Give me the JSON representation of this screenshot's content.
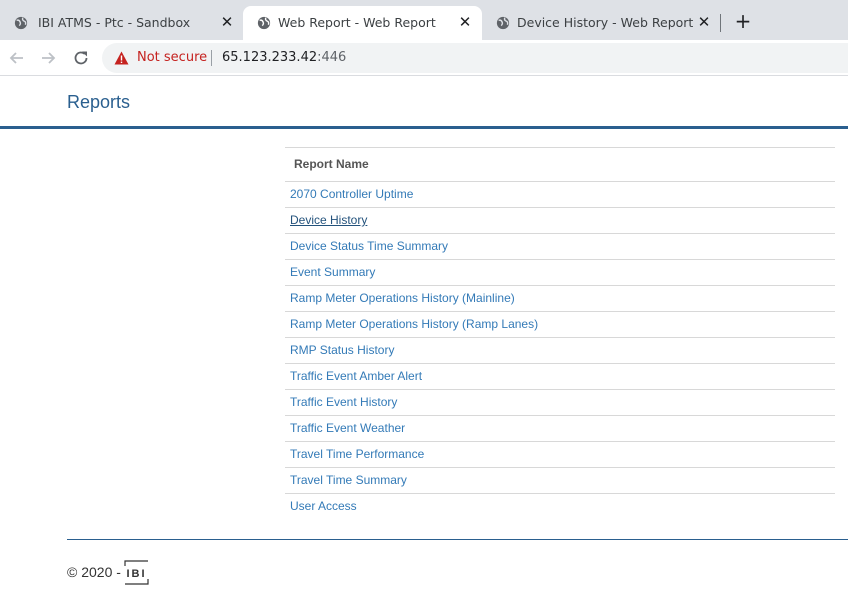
{
  "browser": {
    "tabs": [
      {
        "title": "IBI ATMS - Ptc - Sandbox",
        "close": "✕",
        "active": false
      },
      {
        "title": "Web Report - Web Report",
        "close": "✕",
        "active": true
      },
      {
        "title": "Device History - Web Report",
        "close": "✕",
        "active": false
      }
    ],
    "new_tab_label": "+",
    "security_label": "Not secure",
    "url_host": "65.123.233.42",
    "url_port": ":446",
    "icons": {
      "back": "arrow-left-icon",
      "forward": "arrow-right-icon",
      "reload": "reload-icon",
      "warning": "warning-icon",
      "tab": "globe-icon"
    }
  },
  "page": {
    "title": "Reports",
    "table": {
      "header": "Report Name",
      "rows": [
        "2070 Controller Uptime",
        "Device History",
        "Device Status Time Summary",
        "Event Summary",
        "Ramp Meter Operations History (Mainline)",
        "Ramp Meter Operations History (Ramp Lanes)",
        "RMP Status History",
        "Traffic Event Amber Alert",
        "Traffic Event History",
        "Traffic Event Weather",
        "Travel Time Performance",
        "Travel Time Summary",
        "User Access"
      ],
      "visited_row": "Device History"
    },
    "footer": {
      "copyright": "© 2020 -",
      "logo_text": "IBI"
    }
  },
  "colors": {
    "brand_blue": "#2a5f8f",
    "link": "#337ab7",
    "warning_red": "#c5221f"
  }
}
